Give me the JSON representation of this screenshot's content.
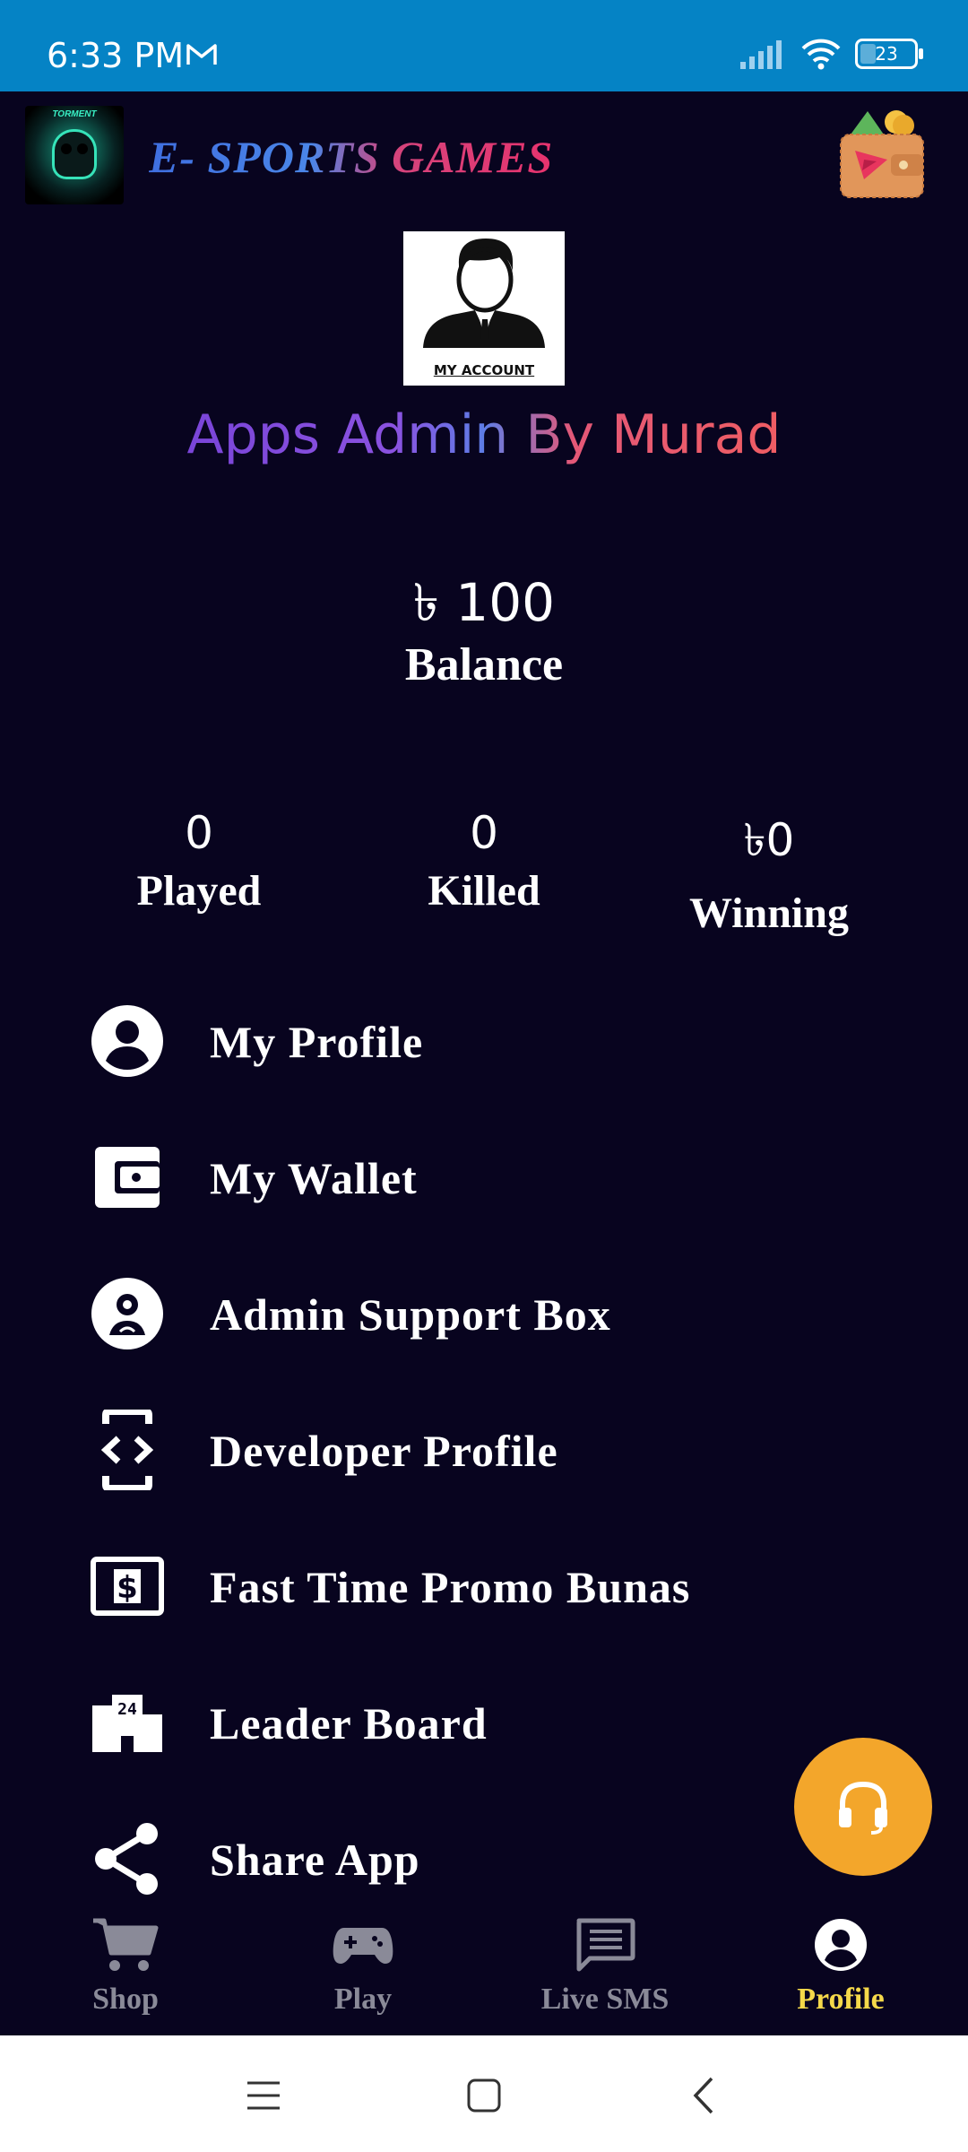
{
  "status_bar": {
    "time": "6:33 PM",
    "battery": "23"
  },
  "header": {
    "logo_text": "TORMENT",
    "brand": "E- SPORTS GAMES"
  },
  "profile": {
    "avatar_label": "MY ACCOUNT",
    "name": "Apps Admin By Murad"
  },
  "balance": {
    "value": "৳ 100",
    "label": "Balance"
  },
  "stats": [
    {
      "value": "0",
      "label": "Played"
    },
    {
      "value": "0",
      "label": "Killed"
    },
    {
      "value": "৳0",
      "label": "Winning"
    }
  ],
  "menu": [
    {
      "label": "My Profile",
      "icon": "account-circle-icon"
    },
    {
      "label": "My Wallet",
      "icon": "wallet-icon"
    },
    {
      "label": "Admin Support Box",
      "icon": "support-agent-icon"
    },
    {
      "label": "Developer Profile",
      "icon": "developer-mode-icon"
    },
    {
      "label": "Fast Time Promo Bunas",
      "icon": "money-icon"
    },
    {
      "label": "Leader  Board",
      "icon": "leaderboard-icon"
    },
    {
      "label": "Share App",
      "icon": "share-icon"
    }
  ],
  "bottom_nav": [
    {
      "label": "Shop",
      "icon": "cart-icon"
    },
    {
      "label": "Play",
      "icon": "gamepad-icon"
    },
    {
      "label": "Live SMS",
      "icon": "chat-icon"
    },
    {
      "label": "Profile",
      "icon": "account-circle-icon",
      "active": true
    }
  ],
  "colors": {
    "background": "#08041f",
    "status_bar": "#0583c5",
    "fab": "#f3a62b",
    "active_nav": "#f5d94a",
    "inactive_nav": "#8a8a98"
  }
}
